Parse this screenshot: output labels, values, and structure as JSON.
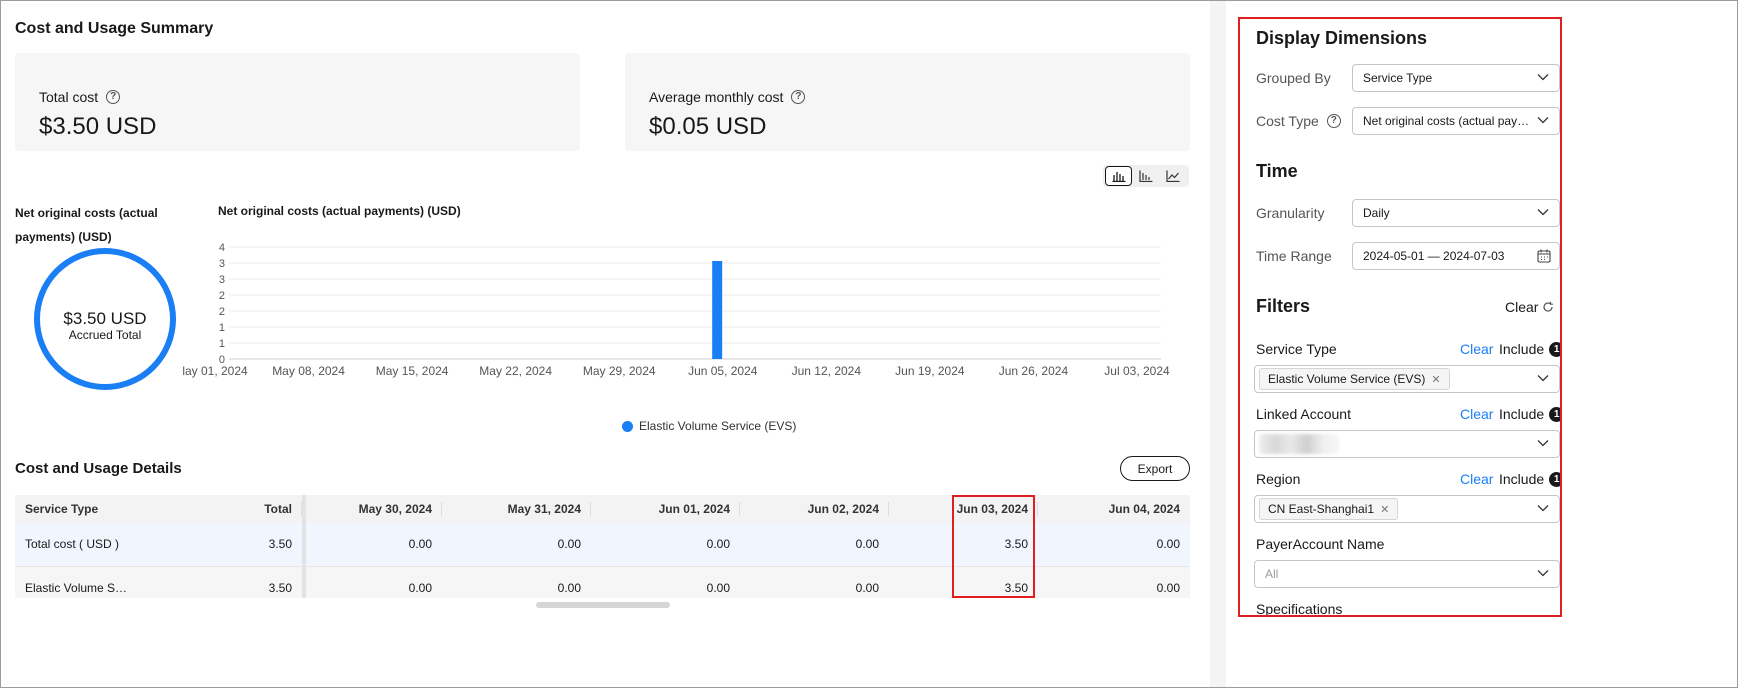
{
  "summary": {
    "title": "Cost and Usage Summary",
    "total_cost_label": "Total cost",
    "total_cost_value": "$3.50 USD",
    "avg_monthly_label": "Average monthly cost",
    "avg_monthly_value": "$0.05 USD"
  },
  "donut": {
    "title": "Net original costs (actual payments) (USD)",
    "value": "$3.50 USD",
    "sub": "Accrued Total"
  },
  "chart_data": {
    "type": "bar",
    "title": "Net original costs (actual payments) (USD)",
    "xlabel": "",
    "ylabel": "",
    "ylim": [
      0,
      4
    ],
    "yticks": [
      0,
      1,
      1,
      2,
      2,
      3,
      3,
      4
    ],
    "xticks": [
      "lay 01, 2024",
      "May 08, 2024",
      "May 15, 2024",
      "May 22, 2024",
      "May 29, 2024",
      "Jun 05, 2024",
      "Jun 12, 2024",
      "Jun 19, 2024",
      "Jun 26, 2024",
      "Jul 03, 2024"
    ],
    "x_start": "2024-05-01",
    "x_end": "2024-07-03",
    "grid": true,
    "series": [
      {
        "name": "Elastic Volume Service (EVS)",
        "color": "#1a7ef5",
        "points": [
          {
            "date": "2024-06-03",
            "value": 3.5
          }
        ]
      }
    ],
    "legend": "bottom-center"
  },
  "chart_icons": [
    "bar-stacked-icon",
    "bar-chart-icon",
    "line-chart-icon"
  ],
  "details": {
    "title": "Cost and Usage Details",
    "export_label": "Export",
    "columns": [
      "Service Type",
      "Total",
      "May 30, 2024",
      "May 31, 2024",
      "Jun 01, 2024",
      "Jun 02, 2024",
      "Jun 03, 2024",
      "Jun 04, 2024"
    ],
    "rows": [
      [
        "Total cost ( USD )",
        "3.50",
        "0.00",
        "0.00",
        "0.00",
        "0.00",
        "3.50",
        "0.00"
      ],
      [
        "Elastic Volume Serv...",
        "3.50",
        "0.00",
        "0.00",
        "0.00",
        "0.00",
        "3.50",
        "0.00"
      ]
    ]
  },
  "side": {
    "display_title": "Display Dimensions",
    "grouped_by_label": "Grouped By",
    "grouped_by_value": "Service Type",
    "cost_type_label": "Cost Type",
    "cost_type_value": "Net original costs (actual paym...",
    "time_title": "Time",
    "granularity_label": "Granularity",
    "granularity_value": "Daily",
    "time_range_label": "Time Range",
    "time_range_value": "2024-05-01 — 2024-07-03",
    "filters_title": "Filters",
    "filters_clear": "Clear",
    "service_type_label": "Service Type",
    "service_type_tag": "Elastic Volume Service (EVS)",
    "linked_account_label": "Linked Account",
    "region_label": "Region",
    "region_tag": "CN East-Shanghai1",
    "payer_label": "PayerAccount Name",
    "payer_placeholder": "All",
    "spec_label": "Specifications",
    "clear": "Clear",
    "include": "Include",
    "include_count": "1"
  },
  "colors": {
    "accent": "#1a7ef5",
    "highlight": "#e02020"
  }
}
